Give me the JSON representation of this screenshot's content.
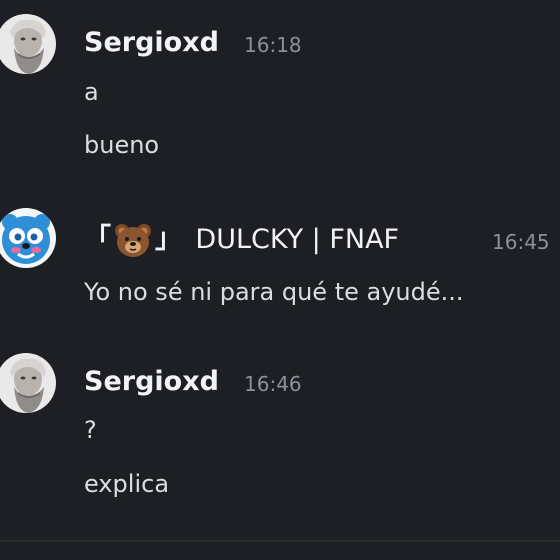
{
  "messages": [
    {
      "author": "Sergioxd",
      "timestamp": "16:18",
      "lines": [
        "a",
        "bueno"
      ]
    },
    {
      "author_prefix": "「",
      "author_emoji": "bear-face-icon",
      "author_suffix": "」",
      "author": "DULCKY | FNAF",
      "timestamp": "16:45",
      "lines": [
        "Yo no sé ni para qué te ayudé..."
      ]
    },
    {
      "author": "Sergioxd",
      "timestamp": "16:46",
      "lines": [
        "?",
        "explica"
      ]
    }
  ],
  "colors": {
    "background": "#1e1f24",
    "username": "#f2f3f5",
    "timestamp": "#8e9099",
    "message_text": "#dbdee1"
  }
}
